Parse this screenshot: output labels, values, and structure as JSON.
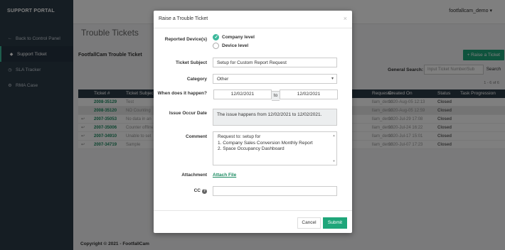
{
  "sidebar": {
    "brand": "SUPPORT PORTAL",
    "items": [
      {
        "icon": "arrow-left-icon",
        "glyph": "←",
        "label": "Back to Control Panel"
      },
      {
        "icon": "tag-icon",
        "glyph": "◆",
        "label": "Support Ticket"
      },
      {
        "icon": "clock-icon",
        "glyph": "◷",
        "label": "SLA Tracker"
      },
      {
        "icon": "cog-icon",
        "glyph": "⚙",
        "label": "RMA Case"
      }
    ]
  },
  "topbar": {
    "user": "footfallcam_demo ▾"
  },
  "page": {
    "title": "Trouble Tickets",
    "subtitle": "FootfallCam Trouble Ticket",
    "raise_button": "+ Raise a Ticket",
    "search_label": "General Search:",
    "search_placeholder": "Input Ticket Number/Sub",
    "search_button": "Search",
    "pager": "1 - 6 of 6"
  },
  "table": {
    "headers": {
      "num": "Ticket #",
      "subj": "Ticket Subject",
      "req": "Requester",
      "date": "Created On",
      "status": "Status",
      "prog": "Task Progression"
    },
    "rows": [
      {
        "reply": "",
        "num": "2008-35129",
        "subj": "Test",
        "req": "llam_demo",
        "date": "2020-Aug-05 12:13",
        "status": "Closed"
      },
      {
        "reply": "",
        "num": "2008-35120",
        "subj": "NO Counting",
        "req": "llam_demo",
        "date": "2020-Aug-05 12:59",
        "status": "Closed"
      },
      {
        "reply": "↩",
        "num": "2007-35053",
        "subj": "No data in an",
        "req": "llam_demo",
        "date": "2020-Jul-29 17:08",
        "status": "Closed"
      },
      {
        "reply": "↩",
        "num": "2007-35006",
        "subj": "Counter offline",
        "req": "llam_demo",
        "date": "2020-Jul-24 16:22",
        "status": "Closed"
      },
      {
        "reply": "↩",
        "num": "2007-34910",
        "subj": "Unable to set",
        "req": "llam_demo",
        "date": "2020-Jul-17 15:01",
        "status": "Closed"
      },
      {
        "reply": "↩",
        "num": "2007-34719",
        "subj": "Sample",
        "req": "llam_demo",
        "date": "2020-Jul-07 17:23",
        "status": "Closed"
      }
    ]
  },
  "footer": {
    "text": "Copyright © 2021 - FootfallCam"
  },
  "modal": {
    "title": "Raise a Trouble Ticket",
    "close": "×",
    "reported_label": "Reported Device(s)",
    "radio_company": "Company level",
    "radio_device": "Device level",
    "subject_label": "Ticket Subject",
    "subject_value": "Setup for Custom Report Request",
    "category_label": "Category",
    "category_value": "Other",
    "when_label": "When does it happen?",
    "date_from": "12/02/2021",
    "date_to_label": "to",
    "date_to": "12/02/2021",
    "issue_label": "Issue Occur Date",
    "issue_value": "The issue happens from 12/02/2021 to 12/02/2021.",
    "comment_label": "Comment",
    "comment_lines": [
      "Request to: setup for",
      "1. Company Sales Conversion Monthly Report",
      "2. Space Occupancy Dashboard"
    ],
    "attachment_label": "Attachment",
    "attach_link": "Attach File",
    "cc_label": "CC",
    "cc_value": "",
    "cancel": "Cancel",
    "submit": "Submit"
  }
}
